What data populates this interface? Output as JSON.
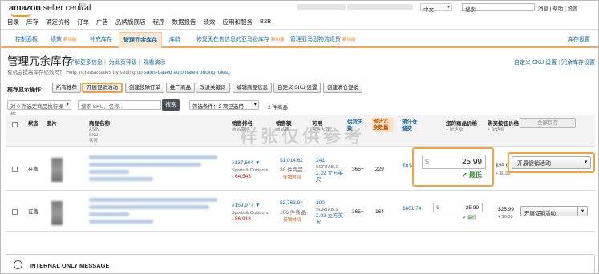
{
  "header": {
    "logo_main": "amazon",
    "logo_sub": "seller central",
    "nav": [
      "目录",
      "库存",
      "确定价格",
      "订单",
      "广告",
      "品牌旗舰店",
      "程序",
      "数据报告",
      "绩效",
      "应用和服务",
      "B2B"
    ],
    "language": "中文",
    "search_placeholder": "搜索",
    "links": "消息 | 帮助 | 设置"
  },
  "tabs": [
    {
      "label": "控制面板",
      "badge": ""
    },
    {
      "label": "绩效",
      "badge": "新功能"
    },
    {
      "label": "补充库存",
      "badge": ""
    },
    {
      "label": "管理冗余库存",
      "badge": "",
      "active": true
    },
    {
      "label": "库龄",
      "badge": ""
    },
    {
      "label": "修复无在售信息的亚马逊库存",
      "badge": "新功能"
    },
    {
      "label": "管理亚马逊物流退货",
      "badge": "新功能"
    },
    {
      "label": "库存设置",
      "badge": ""
    }
  ],
  "page": {
    "title": "管理冗余库存",
    "title_links": [
      "了解更多信息",
      "为此页评级",
      "观看演示"
    ],
    "subtitle": "有机会提高库存绩效吗？ Help increase sales by setting up",
    "subtitle_link": "sales-based automated pricing rules",
    "subtitle_end": "。",
    "right_links": [
      "自定义 SKU 设置",
      "冗余库存设置"
    ]
  },
  "filters": {
    "label": "推荐显示操作:",
    "buttons": [
      "所有推荐",
      "开展促销活动",
      "创建移除订单",
      "推广商品",
      "改进关键词",
      "编辑商品信息",
      "自定义 SKU 设置",
      "创建清仓促销"
    ],
    "highlighted_index": 1
  },
  "toolbar": {
    "batch_action": "对 0 件选定商品执行操作",
    "search_placeholder": "搜索 SKU、名称...",
    "search_button": "搜索",
    "filter": "筛选条件：2 项已选用",
    "count": "2 件商品"
  },
  "columns": {
    "status": "状态",
    "image": "图片",
    "name": "商品名称",
    "name_sub": [
      "ASIN",
      "SKU",
      "状况"
    ],
    "rank": "销售排名",
    "rank_sub": "商品类别",
    "sales": "销售额",
    "sales_sub": "商品数",
    "available": "可用",
    "available_sub": "在售天数",
    "supply_days": "供货天数",
    "excess_units": "预计冗余数量",
    "cost": "预计仓储费",
    "your_price": "您的商品价格",
    "your_price_sub": "+ 配送费",
    "buybox_price": "购买按钮价格",
    "buybox_sub": "+ 配送费",
    "save_all": "全部保存"
  },
  "rows": [
    {
      "status": "在售",
      "rank": "#137,604",
      "rank_dir": "▼",
      "category": "Sports & Outdoors",
      "rank_change": "- 64,545",
      "sales": "$1,014.62",
      "units": "38 件商品",
      "sales_trend": "↓ 促销时间",
      "available": "241",
      "sortable": "SORTABLE",
      "months": "2.32 立方英尺",
      "supply_days": "365+",
      "excess": "229",
      "cost": "$814",
      "price_symbol": "$",
      "price": "25.99",
      "price_label": "✔ 最低",
      "buybox": "$25.9",
      "buybox_ship": "+ $0.00",
      "action": "开展促销活动"
    },
    {
      "status": "在售",
      "rank": "#159,977",
      "rank_dir": "▼",
      "category": "Sports & Outdoors",
      "rank_change": "- 86,918",
      "sales": "$2,763.94",
      "units": "106 件商品",
      "sales_trend": "↓ 促销时间",
      "available": "190",
      "sortable": "SORTABLE",
      "months": "2.03 立方英尺",
      "supply_days": "365+",
      "excess": "164",
      "cost": "$601.74",
      "price_symbol": "$",
      "price": "25.99",
      "price_label": "✔ 最低",
      "buybox": "$25.99",
      "buybox_ship": "+ $0.00",
      "action": "开展促销活动"
    }
  ],
  "internal": "INTERNAL ONLY MESSAGE",
  "watermark": "样张仅供参考",
  "colors": {
    "accent": "#f3a33b",
    "link": "#15699e",
    "tab_underline": "#f4a35b"
  }
}
